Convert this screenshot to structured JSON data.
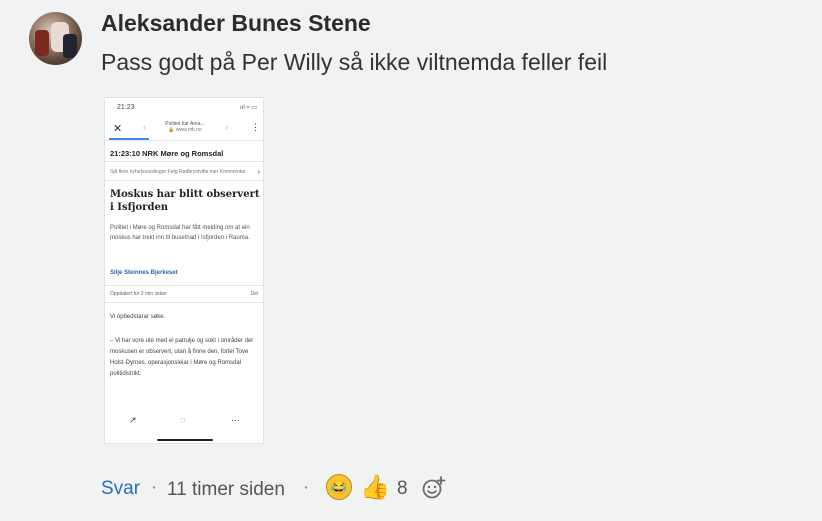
{
  "comment": {
    "author": "Aleksander Bunes Stene",
    "text": "Pass godt på Per Willy så ikke viltnemda feller feil",
    "avatar_icon": "user-avatar-photo"
  },
  "attachment": {
    "status_time": "21:23",
    "status_icons": "ııl ≈ ▭",
    "close": "✕",
    "nav_title_line1": "Politiet har Area...",
    "nav_title_line2": "🔒 www.nrk.no",
    "timestamp": "21:23:10  NRK Møre og Romsdal",
    "tags": "Sjå flere nyhetsvarslinger   Følg Rødbrystvifte mer   Kommentar",
    "headline": "Moskus har blitt observert i Isfjorden",
    "lead": "Politiet i Møre og Romsdal har fått melding om at ein moskus har trekt inn til busetnad i Isfjorden i Rauma.",
    "byline": "Silje Steinnes Bjerkeset",
    "updated": "Oppdatert for 2 min sidan",
    "updated_right": "Del",
    "body1": "Vi opbedstarar søke.",
    "body2": "– Vi har vore ute med ei patrulje og sokt i områder der moskusen er observert, utan å finne den, fortel Tove Holst-Dyrnes, operasjonsleiar i Møre og Romsdal politidistrikt.",
    "icon_share": "↗",
    "icon_reload": "◌",
    "icon_more": "···"
  },
  "actions": {
    "reply_label": "Svar",
    "separator": "·",
    "time_label": "11 timer siden",
    "reaction_count": "8",
    "laugh_icon": "laughing-emoji-icon",
    "thumb_icon": "thumbs-up-emoji-icon",
    "add_reaction_icon": "add-reaction-icon"
  },
  "colors": {
    "background": "#f1f2f2",
    "link": "#2a6fbe",
    "text": "#333333"
  }
}
